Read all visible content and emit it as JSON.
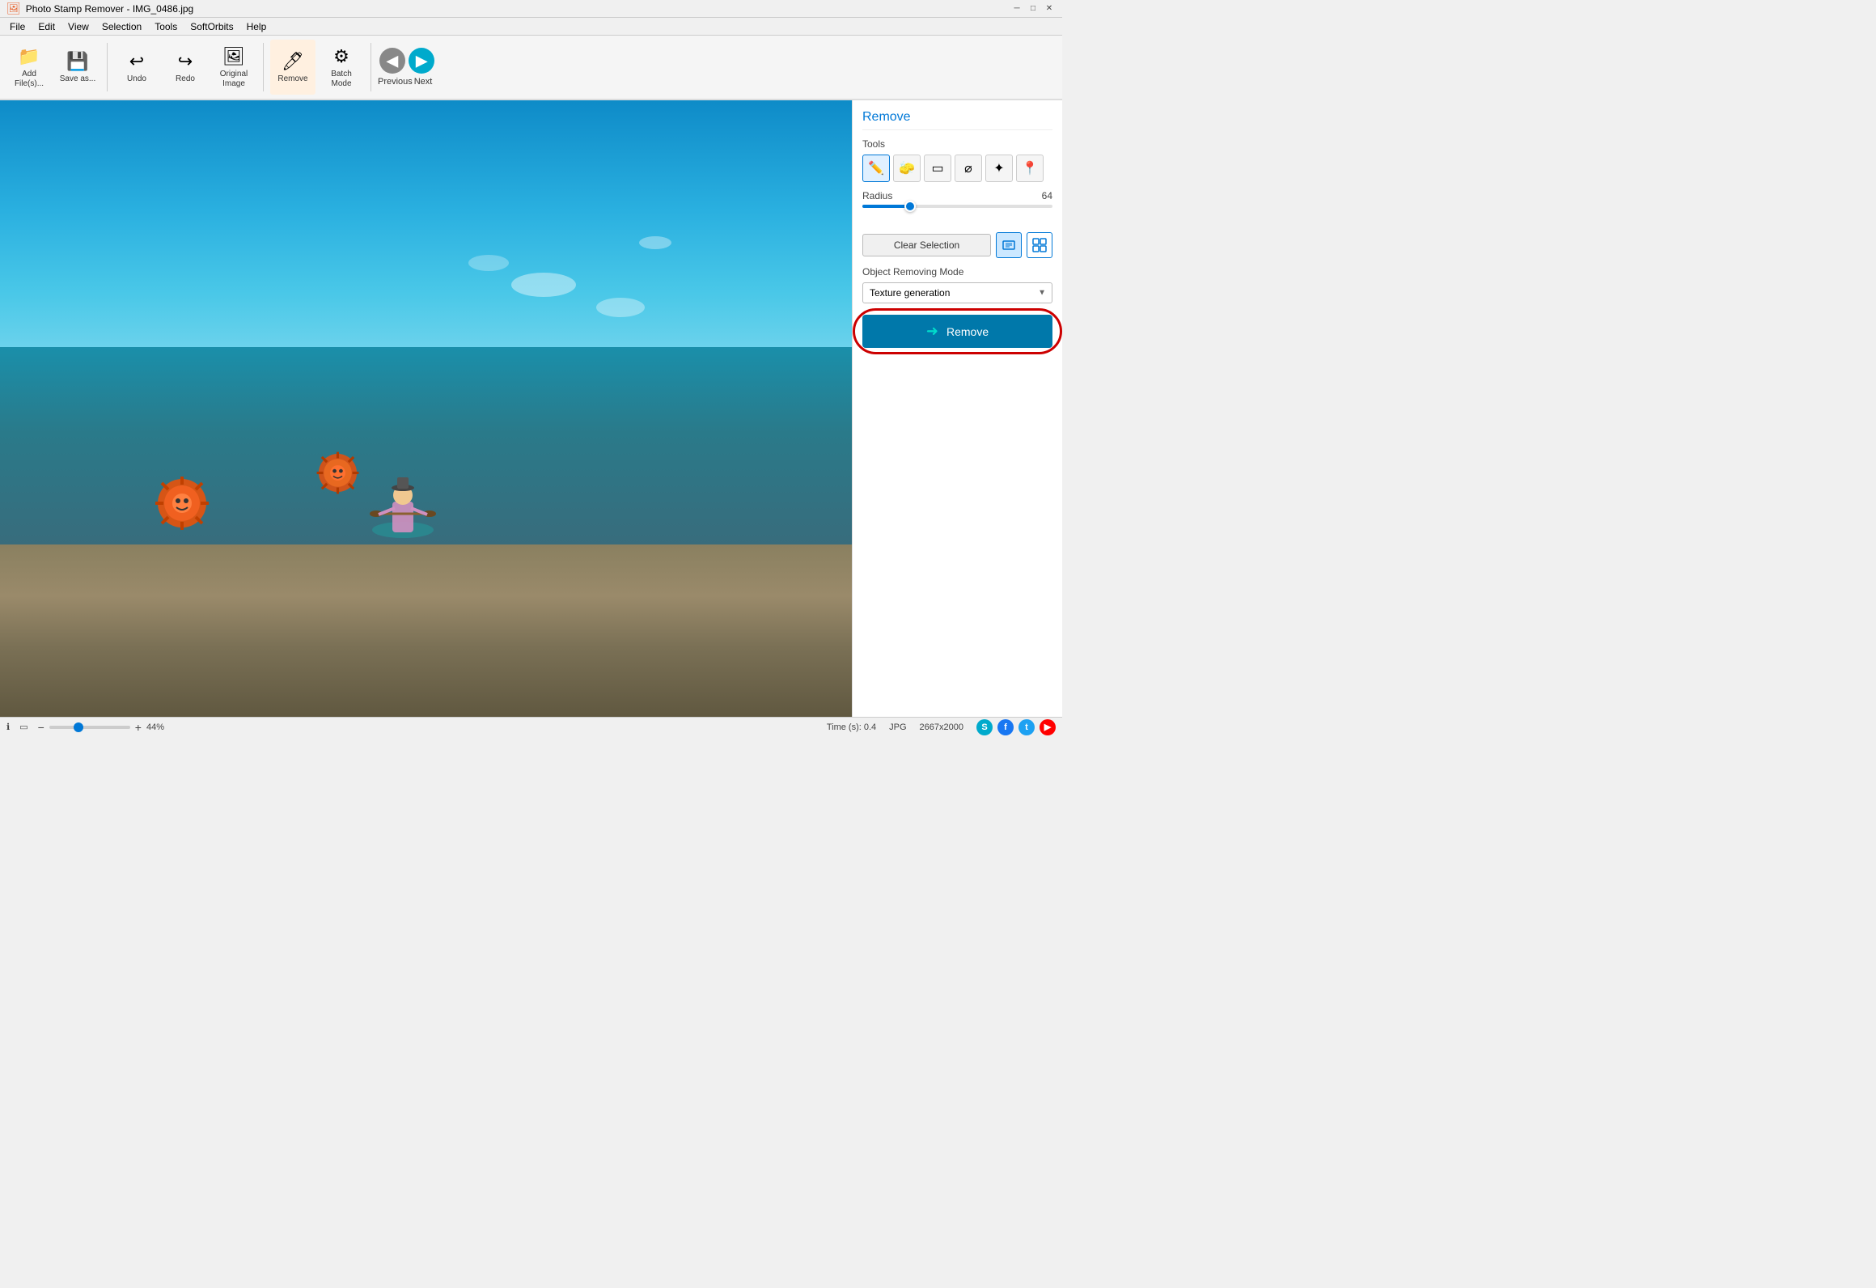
{
  "titlebar": {
    "icon": "🖼",
    "title": "Photo Stamp Remover - IMG_0486.jpg",
    "minimize": "─",
    "maximize": "□",
    "close": "✕"
  },
  "menubar": {
    "items": [
      "File",
      "Edit",
      "View",
      "Selection",
      "Tools",
      "SoftOrbits",
      "Help"
    ]
  },
  "toolbar": {
    "add_label": "Add\nFile(s)...",
    "save_label": "Save\nas...",
    "undo_label": "Undo",
    "redo_label": "Redo",
    "original_label": "Original\nImage",
    "remove_label": "Remove",
    "batch_label": "Batch\nMode",
    "previous_label": "Previous",
    "next_label": "Next"
  },
  "canvas": {
    "zoom_percent": "44%",
    "time": "Time (s): 0.4",
    "format": "JPG",
    "dimensions": "2667x2000"
  },
  "panel": {
    "title": "Remove",
    "tools_label": "Tools",
    "radius_label": "Radius",
    "radius_value": "64",
    "radius_percent": 25,
    "clear_selection_label": "Clear Selection",
    "object_removing_mode_label": "Object Removing Mode",
    "texture_generation_label": "Texture generation",
    "remove_btn_label": "Remove"
  },
  "status": {
    "time_label": "Time (s): 0.4",
    "format": "JPG",
    "dimensions": "2667x2000"
  }
}
